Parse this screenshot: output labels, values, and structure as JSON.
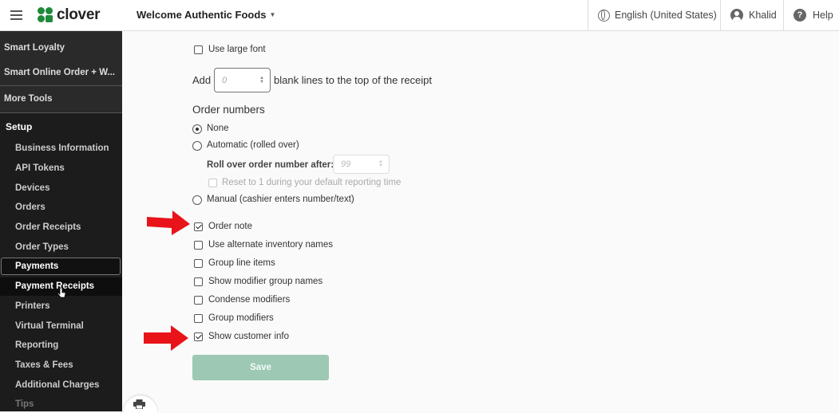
{
  "brand": {
    "name": "clover",
    "color": "#1f8a3a"
  },
  "header": {
    "merchant": "Welcome Authentic Foods",
    "language": "English (United States)",
    "user": "Khalid",
    "help": "Help"
  },
  "sidebar": {
    "top_items": [
      "Smart Loyalty",
      "Smart Online Order + W...",
      "More Tools"
    ],
    "section": "Setup",
    "items": [
      "Business Information",
      "API Tokens",
      "Devices",
      "Orders",
      "Order Receipts",
      "Order Types",
      "Payments",
      "Payment Receipts",
      "Printers",
      "Virtual Terminal",
      "Reporting",
      "Taxes & Fees",
      "Additional Charges",
      "Tips"
    ],
    "active_item": "Payments"
  },
  "form": {
    "large_font": {
      "label": "Use large font",
      "checked": false
    },
    "blank_lines": {
      "prefix": "Add",
      "placeholder": "0",
      "suffix": "blank lines to the top of the receipt"
    },
    "order_numbers": {
      "heading": "Order numbers",
      "none": "None",
      "automatic": "Automatic (rolled over)",
      "rollover_label": "Roll over order number after:",
      "rollover_placeholder": "99",
      "reset_label": "Reset to 1 during your default reporting time",
      "manual": "Manual (cashier enters number/text)",
      "selected": "None"
    },
    "options": [
      {
        "label": "Order note",
        "checked": true
      },
      {
        "label": "Use alternate inventory names",
        "checked": false
      },
      {
        "label": "Group line items",
        "checked": false
      },
      {
        "label": "Show modifier group names",
        "checked": false
      },
      {
        "label": "Condense modifiers",
        "checked": false
      },
      {
        "label": "Group modifiers",
        "checked": false
      },
      {
        "label": "Show customer info",
        "checked": true
      }
    ],
    "save_label": "Save"
  },
  "colors": {
    "arrow": "#e8141a",
    "save_button": "#9dc8b4",
    "sidebar_bg": "#1c1c1c"
  },
  "icons": {
    "menu": "hamburger-icon",
    "globe": "globe-icon",
    "user": "user-icon",
    "help": "help-icon",
    "print": "print-icon",
    "cursor": "pointer-cursor-icon"
  }
}
